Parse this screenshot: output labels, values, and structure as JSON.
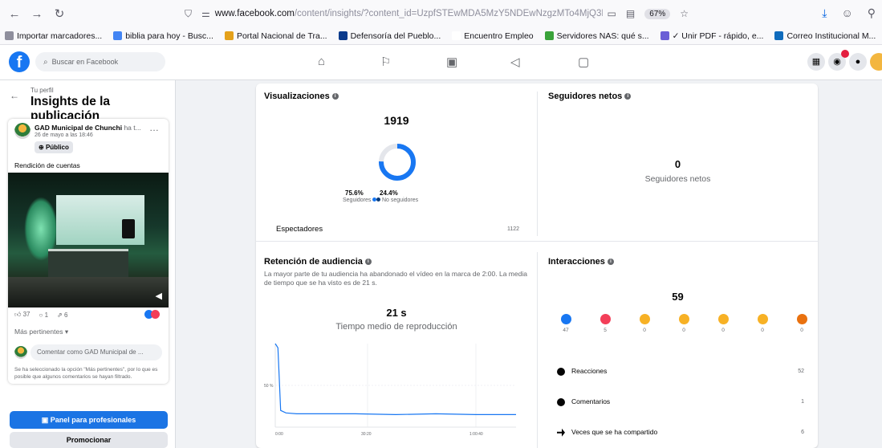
{
  "browser": {
    "url_host": "www.facebook.com",
    "url_path": "/content/insights/?content_id=UzpfSTEwMDA5MzY5NDEwNzgzMTo4MjQ3MD",
    "zoom": "67%",
    "bookmarks": [
      {
        "label": "Importar marcadores...",
        "color": "#8f8f9d"
      },
      {
        "label": "biblia para hoy - Busc...",
        "color": "#4285f4"
      },
      {
        "label": "Portal Nacional de Tra...",
        "color": "#e4a11b"
      },
      {
        "label": "Defensoría del Pueblo...",
        "color": "#0b3b8c"
      },
      {
        "label": "Encuentro Empleo",
        "color": "#ffffff"
      },
      {
        "label": "Servidores NAS: qué s...",
        "color": "#3aa33a"
      },
      {
        "label": "✓ Unir PDF - rápido, e...",
        "color": "#6b5fd6"
      },
      {
        "label": "Correo Institucional M...",
        "color": "#0f6cbd"
      }
    ]
  },
  "facebook": {
    "logo": "f",
    "search_placeholder": "Buscar en Facebook"
  },
  "left": {
    "crumb": "Tu perfil",
    "title": "Insights de la publicación",
    "page_name": "GAD Municipal de Chunchi",
    "page_name_rest": " ha t...",
    "date": "26 de mayo a las 18:46",
    "visibility": "Público",
    "post_text": "Rendición de cuentas",
    "stats": {
      "likes": "37",
      "comments": "1",
      "shares": "6"
    },
    "sort": "Más pertinentes",
    "comment_placeholder": "Comentar como GAD Municipal de ...",
    "note": "Se ha seleccionado la opción \"Más pertinentes\", por lo que es posible que algunos comentarios se hayan filtrado.",
    "btn_panel": "Panel para profesionales",
    "btn_promo": "Promocionar"
  },
  "views": {
    "title": "Visualizaciones",
    "total": "1919",
    "followers_pct": "75.6%",
    "followers_label": "Seguidores",
    "nonfollowers_pct": "24.4%",
    "nonfollowers_label": "No seguidores",
    "viewers_label": "Espectadores",
    "viewers_value": "1122"
  },
  "net": {
    "title": "Seguidores netos",
    "value": "0",
    "label": "Seguidores netos"
  },
  "retention": {
    "title": "Retención de audiencia",
    "desc": "La mayor parte de tu audiencia ha abandonado el vídeo en la marca de 2:00. La media de tiempo que se ha visto es de 21 s.",
    "avg": "21 s",
    "avg_label": "Tiempo medio de reproducción",
    "y_tick": "50 %",
    "x_ticks": [
      "0:00",
      "30:20",
      "1:00:40"
    ]
  },
  "interactions": {
    "title": "Interacciones",
    "total": "59",
    "reactions": [
      {
        "name": "like",
        "count": "47",
        "color": "#1877f2"
      },
      {
        "name": "love",
        "count": "5",
        "color": "#f33e58"
      },
      {
        "name": "care",
        "count": "0",
        "color": "#f7b125"
      },
      {
        "name": "haha",
        "count": "0",
        "color": "#f7b125"
      },
      {
        "name": "wow",
        "count": "0",
        "color": "#f7b125"
      },
      {
        "name": "sad",
        "count": "0",
        "color": "#f7b125"
      },
      {
        "name": "angry",
        "count": "0",
        "color": "#e9710f"
      }
    ],
    "rows": [
      {
        "label": "Reacciones",
        "value": "52"
      },
      {
        "label": "Comentarios",
        "value": "1"
      },
      {
        "label": "Veces que se ha compartido",
        "value": "6"
      }
    ]
  },
  "chart_data": {
    "type": "line",
    "title": "",
    "x": [
      0,
      1,
      2,
      4,
      8,
      15,
      30,
      45,
      60,
      75,
      90
    ],
    "values": [
      100,
      95,
      20,
      17,
      16,
      16,
      16,
      15,
      16,
      15,
      15
    ],
    "y_ticks": [
      "50 %"
    ],
    "x_ticks": [
      "0:00",
      "30:20",
      "1:00:40"
    ],
    "color": "#1877f2"
  }
}
